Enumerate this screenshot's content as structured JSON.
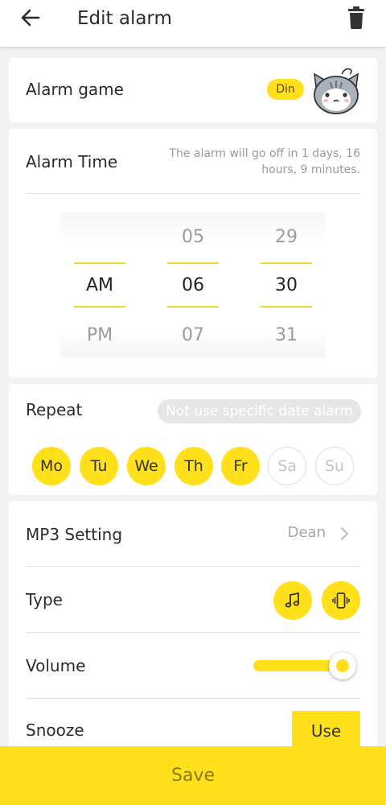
{
  "header": {
    "title": "Edit alarm",
    "back_icon": "arrow-left-icon",
    "delete_icon": "trash-icon"
  },
  "alarm_game": {
    "label": "Alarm game",
    "badge": "Din",
    "avatar_icon": "cat-face-icon"
  },
  "alarm_time": {
    "label": "Alarm Time",
    "note": "The alarm will go off in 1 days, 16 hours, 9 minutes.",
    "picker": {
      "period": {
        "prev": "",
        "selected": "AM",
        "next": "PM"
      },
      "hour": {
        "prev": "05",
        "selected": "06",
        "next": "07"
      },
      "minute": {
        "prev": "29",
        "selected": "30",
        "next": "31"
      }
    }
  },
  "repeat": {
    "label": "Repeat",
    "specific_date_button": "Not use specific date alarm",
    "days": [
      {
        "label": "Mo",
        "on": true
      },
      {
        "label": "Tu",
        "on": true
      },
      {
        "label": "We",
        "on": true
      },
      {
        "label": "Th",
        "on": true
      },
      {
        "label": "Fr",
        "on": true
      },
      {
        "label": "Sa",
        "on": false
      },
      {
        "label": "Su",
        "on": false
      }
    ]
  },
  "settings": {
    "mp3": {
      "label": "MP3 Setting",
      "value": "Dean",
      "icon": "chevron-right-icon"
    },
    "type": {
      "label": "Type",
      "options": [
        "music-note-icon",
        "vibrate-icon"
      ]
    },
    "volume": {
      "label": "Volume",
      "level_percent": 100
    },
    "snooze": {
      "label": "Snooze",
      "button": "Use"
    }
  },
  "footer": {
    "save_label": "Save"
  },
  "colors": {
    "accent": "#ffe01b",
    "background": "#f2f2f2",
    "card": "#ffffff"
  }
}
